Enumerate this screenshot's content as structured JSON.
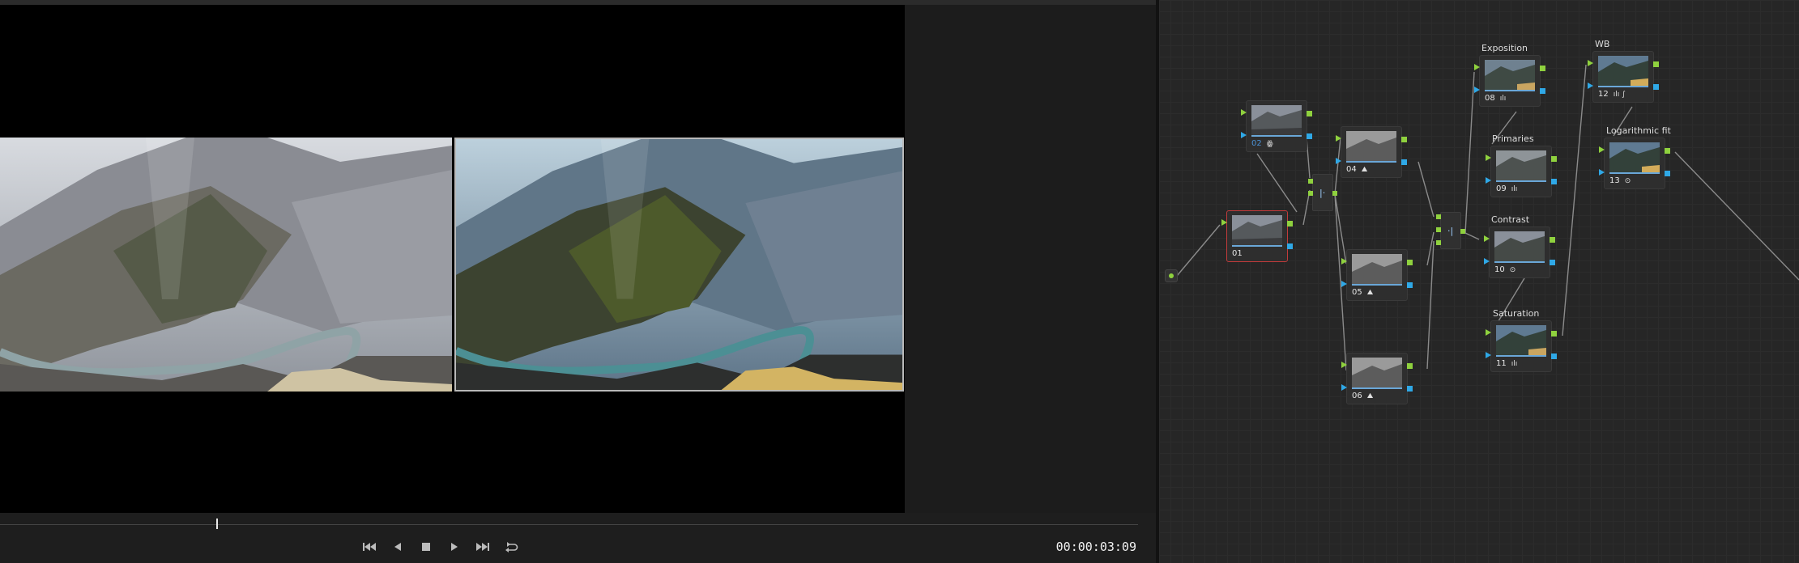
{
  "viewer": {
    "timecode": "00:00:03:09",
    "transport": [
      {
        "name": "jump-to-start-button",
        "icon": "skip-back-icon"
      },
      {
        "name": "play-reverse-button",
        "icon": "play-reverse-icon"
      },
      {
        "name": "stop-button",
        "icon": "stop-icon"
      },
      {
        "name": "play-forward-button",
        "icon": "play-icon"
      },
      {
        "name": "jump-to-end-button",
        "icon": "skip-forward-icon"
      },
      {
        "name": "loop-button",
        "icon": "loop-icon"
      }
    ],
    "playhead_fraction": 0.19
  },
  "nodes": [
    {
      "id": "n01",
      "number": "01",
      "label": "",
      "icon": ""
    },
    {
      "id": "n02",
      "number": "02",
      "label": "",
      "icon": "ꙮ"
    },
    {
      "id": "n04",
      "number": "04",
      "label": "",
      "icon": "⛰"
    },
    {
      "id": "n05",
      "number": "05",
      "label": "",
      "icon": "⛰"
    },
    {
      "id": "n06",
      "number": "06",
      "label": "",
      "icon": "⛰"
    },
    {
      "id": "n08",
      "number": "08",
      "label": "Exposition",
      "icon": "ılı"
    },
    {
      "id": "n09",
      "number": "09",
      "label": "Primaries",
      "icon": "ılı"
    },
    {
      "id": "n10",
      "number": "10",
      "label": "Contrast",
      "icon": "⊙"
    },
    {
      "id": "n11",
      "number": "11",
      "label": "Saturation",
      "icon": "ılı"
    },
    {
      "id": "n12",
      "number": "12",
      "label": "WB",
      "icon": "ılı ∫"
    },
    {
      "id": "n13",
      "number": "13",
      "label": "Logarithmic fit",
      "icon": "⊙"
    }
  ],
  "colors": {
    "port_green": "#8fd13e",
    "port_blue": "#2fa8e6",
    "selected_border": "#c23b3b"
  }
}
